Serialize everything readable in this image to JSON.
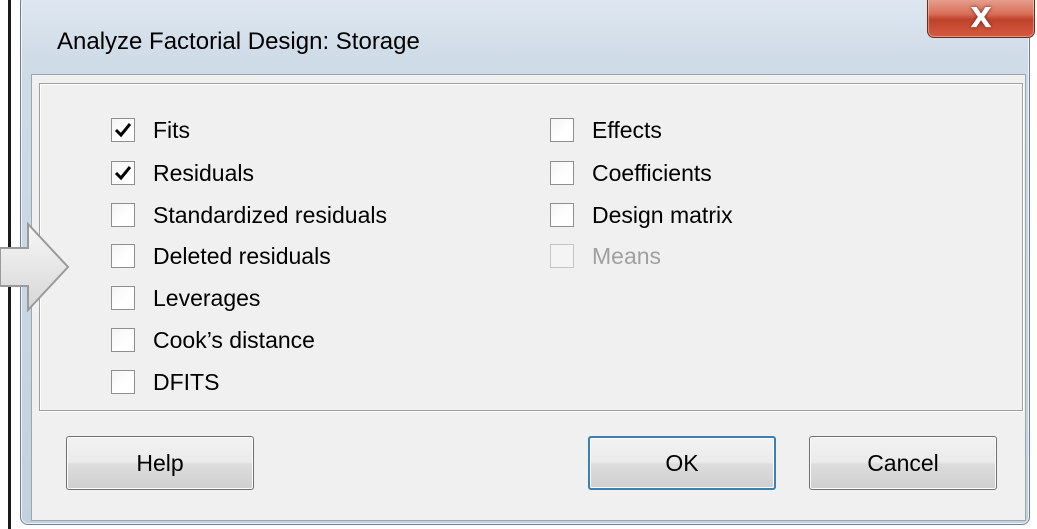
{
  "window": {
    "title": "Analyze Factorial Design: Storage",
    "close_glyph": "X"
  },
  "options": {
    "left_column": [
      {
        "label": "Fits",
        "checked": true,
        "enabled": true
      },
      {
        "label": "Residuals",
        "checked": true,
        "enabled": true
      },
      {
        "label": "Standardized residuals",
        "checked": false,
        "enabled": true
      },
      {
        "label": "Deleted residuals",
        "checked": false,
        "enabled": true
      },
      {
        "label": "Leverages",
        "checked": false,
        "enabled": true
      },
      {
        "label": "Cook’s distance",
        "checked": false,
        "enabled": true
      },
      {
        "label": "DFITS",
        "checked": false,
        "enabled": true
      }
    ],
    "right_column": [
      {
        "label": "Effects",
        "checked": false,
        "enabled": true
      },
      {
        "label": "Coefficients",
        "checked": false,
        "enabled": true
      },
      {
        "label": "Design matrix",
        "checked": false,
        "enabled": true
      },
      {
        "label": "Means",
        "checked": false,
        "enabled": false
      }
    ]
  },
  "buttons": {
    "help": "Help",
    "ok": "OK",
    "cancel": "Cancel"
  },
  "icons": {
    "close": "close-icon",
    "check": "checkmark-icon",
    "callout": "arrow-right-icon"
  },
  "colors": {
    "close_button": "#c9503a",
    "frame": "#c3d1df",
    "client": "#f0f0f0",
    "disabled_text": "#a0a0a0"
  }
}
